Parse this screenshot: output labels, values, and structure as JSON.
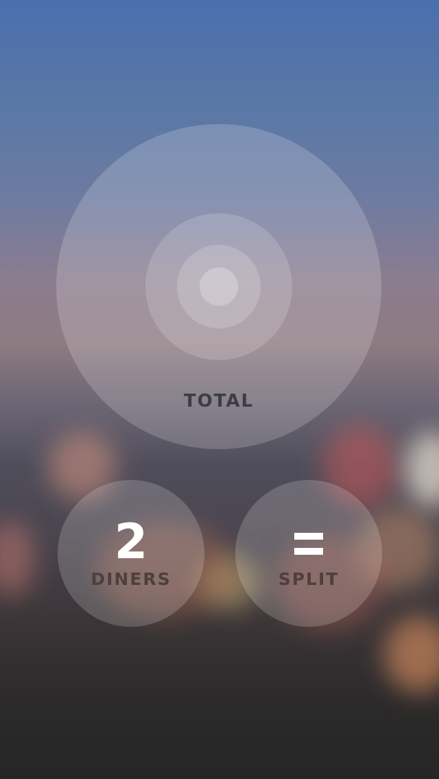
{
  "total": {
    "label": "TOTAL"
  },
  "diners": {
    "count": "2",
    "label": "DINERS"
  },
  "split": {
    "icon": "equals-icon",
    "label": "SPLIT"
  }
}
